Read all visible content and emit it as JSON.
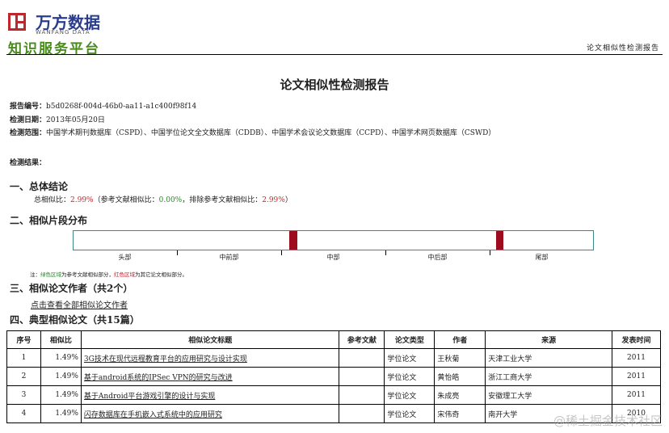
{
  "header": {
    "brand_cn": "万方数据",
    "brand_en": "WANFANG DATA",
    "platform": "知识服务平台",
    "doc_type": "论文相似性检测报告"
  },
  "title": "论文相似性检测报告",
  "meta": {
    "report_no_label": "报告编号：",
    "report_no": "b5d0268f-004d-46b0-aa11-a1c400f98f14",
    "date_label": "检测日期：",
    "date": "2013年05月20日",
    "scope_label": "检测范围：",
    "scope": "中国学术期刊数据库（CSPD）、中国学位论文全文数据库（CDDB）、中国学术会议论文数据库（CCPD）、中国学术网页数据库（CSWD）",
    "result_label": "检测结果："
  },
  "sec1": {
    "title": "一、总体结论",
    "p1": "总相似比：",
    "total": "2.99%",
    "p2": "（参考文献相似比：",
    "ref": "0.00%",
    "p3": "，排除参考文献相似比：",
    "excl": "2.99%",
    "p4": "）"
  },
  "sec2": {
    "title": "二、相似片段分布",
    "segments": [
      "头部",
      "中前部",
      "中部",
      "中后部",
      "尾部"
    ],
    "marks": [
      {
        "start": 0.415,
        "width": 0.016,
        "color": "#9e0a1e"
      },
      {
        "start": 0.814,
        "width": 0.013,
        "color": "#9e0a1e"
      }
    ],
    "note": {
      "a": "注：",
      "green": "绿色区域",
      "b": "为参考文献相似部分，",
      "red": "红色区域",
      "c": "为其它论文相似部分。"
    }
  },
  "sec3": {
    "title": "三、相似论文作者（共2个）",
    "link": "点击查看全部相似论文作者"
  },
  "sec4": {
    "title": "四、典型相似论文（共15篇）",
    "headers": [
      "序号",
      "相似比",
      "相似论文标题",
      "参考文献",
      "论文类型",
      "作者",
      "来源",
      "发表时间"
    ],
    "rows": [
      {
        "no": "1",
        "ratio": "1.49%",
        "title": "3G技术在现代远程教育平台的应用研究与设计实现",
        "ref": "",
        "type": "学位论文",
        "author": "王秋菊",
        "source": "天津工业大学",
        "year": "2011"
      },
      {
        "no": "2",
        "ratio": "1.49%",
        "title": "基于android系统的IPSec VPN的研究与改进",
        "ref": "",
        "type": "学位论文",
        "author": "黄怡皓",
        "source": "浙江工商大学",
        "year": "2011"
      },
      {
        "no": "3",
        "ratio": "1.49%",
        "title": "基于Android平台游戏引擎的设计与实现",
        "ref": "",
        "type": "学位论文",
        "author": "朱成亮",
        "source": "安徽理工大学",
        "year": "2011"
      },
      {
        "no": "4",
        "ratio": "1.49%",
        "title": "闪存数据库在手机嵌入式系统中的应用研究",
        "ref": "",
        "type": "学位论文",
        "author": "宋伟奇",
        "source": "南开大学",
        "year": "2010"
      }
    ]
  },
  "watermark": "@稀土掘金技术社区"
}
